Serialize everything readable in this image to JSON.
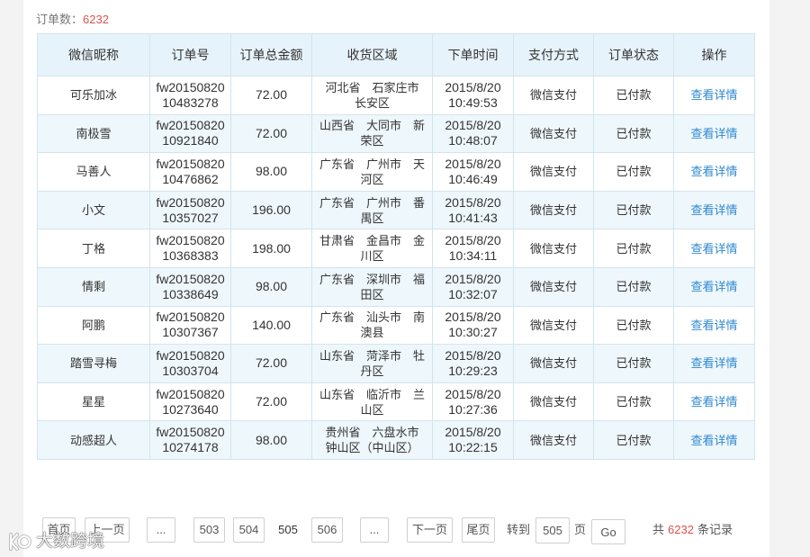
{
  "colors": {
    "count_red": "#d9534f",
    "link_blue": "#2f88d0",
    "header_bg": "#e7f3fa",
    "stripe_bg": "#eef7fc",
    "grid_line": "#d3e4ee"
  },
  "summary": {
    "label": "订单数：",
    "count": "6232"
  },
  "table": {
    "columns": [
      "微信昵称",
      "订单号",
      "订单总金额",
      "收货区域",
      "下单时间",
      "支付方式",
      "订单状态",
      "操作"
    ],
    "rows": [
      {
        "nickname": "可乐加冰",
        "order_no": "fw2015082010483278",
        "amount": "72.00",
        "region": "河北省　石家庄市　长安区",
        "order_time": "2015/8/20 10:49:53",
        "payment": "微信支付",
        "status": "已付款",
        "action": "查看详情"
      },
      {
        "nickname": "南极雪",
        "order_no": "fw2015082010921840",
        "amount": "72.00",
        "region": "山西省　大同市　新荣区",
        "order_time": "2015/8/20 10:48:07",
        "payment": "微信支付",
        "status": "已付款",
        "action": "查看详情"
      },
      {
        "nickname": "马善人",
        "order_no": "fw2015082010476862",
        "amount": "98.00",
        "region": "广东省　广州市　天河区",
        "order_time": "2015/8/20 10:46:49",
        "payment": "微信支付",
        "status": "已付款",
        "action": "查看详情"
      },
      {
        "nickname": "小文",
        "order_no": "fw2015082010357027",
        "amount": "196.00",
        "region": "广东省　广州市　番禺区",
        "order_time": "2015/8/20 10:41:43",
        "payment": "微信支付",
        "status": "已付款",
        "action": "查看详情"
      },
      {
        "nickname": "丁格",
        "order_no": "fw2015082010368383",
        "amount": "198.00",
        "region": "甘肃省　金昌市　金川区",
        "order_time": "2015/8/20 10:34:11",
        "payment": "微信支付",
        "status": "已付款",
        "action": "查看详情"
      },
      {
        "nickname": "情剩",
        "order_no": "fw2015082010338649",
        "amount": "98.00",
        "region": "广东省　深圳市　福田区",
        "order_time": "2015/8/20 10:32:07",
        "payment": "微信支付",
        "status": "已付款",
        "action": "查看详情"
      },
      {
        "nickname": "阿鹏",
        "order_no": "fw2015082010307367",
        "amount": "140.00",
        "region": "广东省　汕头市　南澳县",
        "order_time": "2015/8/20 10:30:27",
        "payment": "微信支付",
        "status": "已付款",
        "action": "查看详情"
      },
      {
        "nickname": "踏雪寻梅",
        "order_no": "fw2015082010303704",
        "amount": "72.00",
        "region": "山东省　菏泽市　牡丹区",
        "order_time": "2015/8/20 10:29:23",
        "payment": "微信支付",
        "status": "已付款",
        "action": "查看详情"
      },
      {
        "nickname": "星星",
        "order_no": "fw2015082010273640",
        "amount": "72.00",
        "region": "山东省　临沂市　兰山区",
        "order_time": "2015/8/20 10:27:36",
        "payment": "微信支付",
        "status": "已付款",
        "action": "查看详情"
      },
      {
        "nickname": "动感超人",
        "order_no": "fw2015082010274178",
        "amount": "98.00",
        "region": "贵州省　六盘水市　钟山区（中山区）",
        "order_time": "2015/8/20 10:22:15",
        "payment": "微信支付",
        "status": "已付款",
        "action": "查看详情"
      }
    ]
  },
  "pagination": {
    "first": "首页",
    "prev": "上一页",
    "ellipsis": "...",
    "pages": [
      {
        "label": "503",
        "current": false
      },
      {
        "label": "504",
        "current": false
      },
      {
        "label": "505",
        "current": true
      },
      {
        "label": "506",
        "current": false
      }
    ],
    "next": "下一页",
    "last": "尾页",
    "goto_label": "转到",
    "goto_value": "505",
    "page_unit": "页",
    "go_button": "Go",
    "total_prefix": "共",
    "total_count": "6232",
    "total_suffix": "条记录"
  },
  "watermark": {
    "text": "大数跨境"
  }
}
